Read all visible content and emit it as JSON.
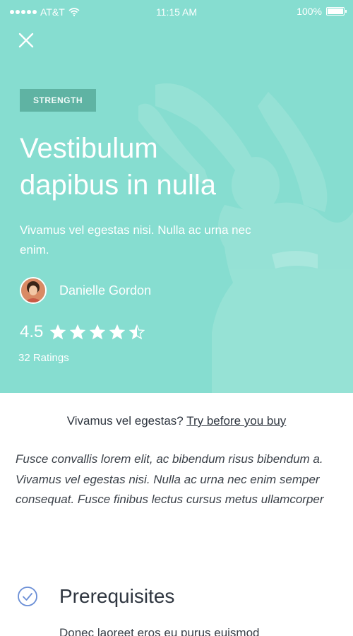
{
  "status_bar": {
    "carrier": "AT&T",
    "time": "11:15 AM",
    "battery": "100%",
    "icons": [
      "signal-icon",
      "wifi-icon",
      "battery-icon"
    ]
  },
  "header": {
    "close_icon": "close-icon"
  },
  "hero": {
    "category": "STRENGTH",
    "title": "Vestibulum dapibus in nulla",
    "subtitle": "Vivamus vel egestas nisi. Nulla ac urna nec enim.",
    "background_color": "#86ddd0",
    "author": {
      "name": "Danielle Gordon",
      "avatar_icon": "avatar"
    },
    "rating": {
      "value": "4.5",
      "stars": 4.5,
      "max_stars": 5,
      "count_text": "32 Ratings"
    }
  },
  "trial": {
    "question": "Vivamus vel egestas?",
    "link": "Try before you buy"
  },
  "description": "Fusce convallis lorem elit, ac bibendum risus bibendum a. Vivamus vel egestas nisi. Nulla ac urna nec enim semper consequat. Fusce finibus lectus cursus metus ullamcorper",
  "prerequisites": {
    "title": "Prerequisites",
    "icon": "check-circle-icon",
    "accent_color": "#6b8fd6",
    "first_line": "Donec laoreet eros eu purus euismod"
  }
}
